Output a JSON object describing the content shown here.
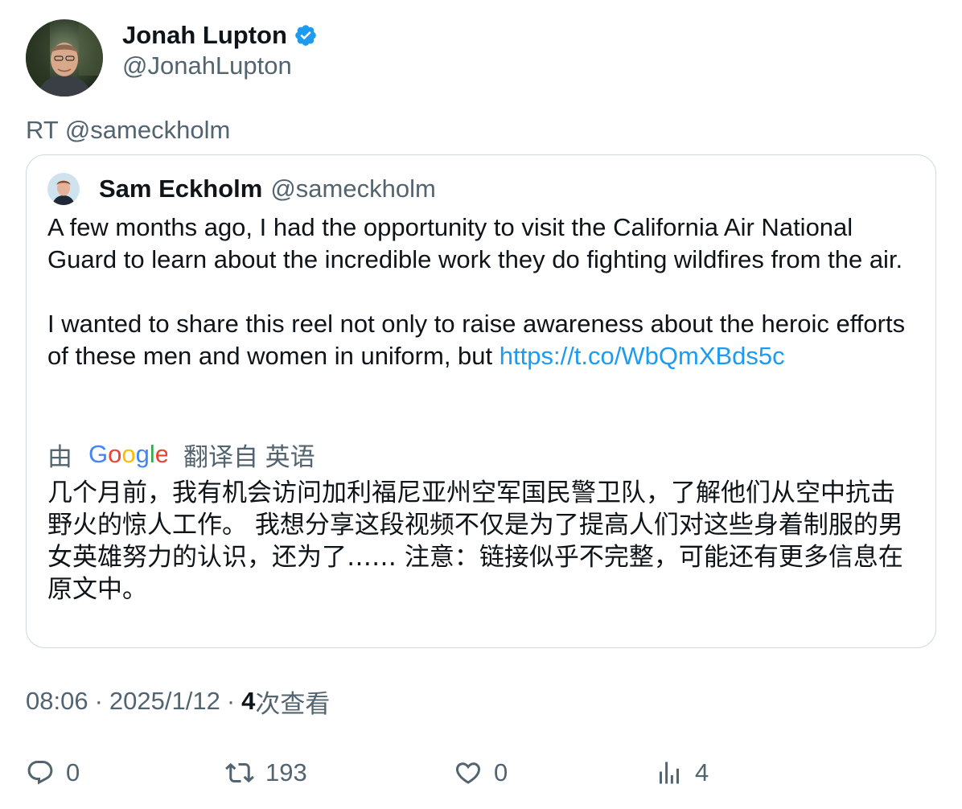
{
  "author": {
    "display_name": "Jonah Lupton",
    "handle": "@JonahLupton",
    "verified_icon": "verified-badge-icon"
  },
  "retweet_line": "RT @sameckholm",
  "quoted": {
    "display_name": "Sam Eckholm",
    "handle": "@sameckholm",
    "para1": "A few months ago, I had the opportunity to visit the California Air National Guard to learn about the incredible work they do fighting wildfires from the air.",
    "para2_text": "I wanted to share this reel not only to raise awareness about the heroic efforts of these men and women in uniform, but ",
    "para2_link": "https://t.co/WbQmXBds5c",
    "translation_prefix": "由",
    "translation_provider": "Google",
    "translation_suffix": "翻译自 英语",
    "translated_text": "几个月前，我有机会访问加利福尼亚州空军国民警卫队，了解他们从空中抗击野火的惊人工作。 我想分享这段视频不仅是为了提高人们对这些身着制服的男女英雄努力的认识，还为了…… 注意：链接似乎不完整，可能还有更多信息在原文中。"
  },
  "meta": {
    "time": "08:06",
    "separator": "·",
    "date": "2025/1/12",
    "views_count": "4",
    "views_label": "次查看"
  },
  "actions": {
    "replies": "0",
    "retweets": "193",
    "likes": "0",
    "views": "4"
  },
  "colors": {
    "secondary_text": "#536471",
    "link": "#1d9bf0",
    "border": "#cfd9de",
    "verified": "#1d9bf0"
  }
}
